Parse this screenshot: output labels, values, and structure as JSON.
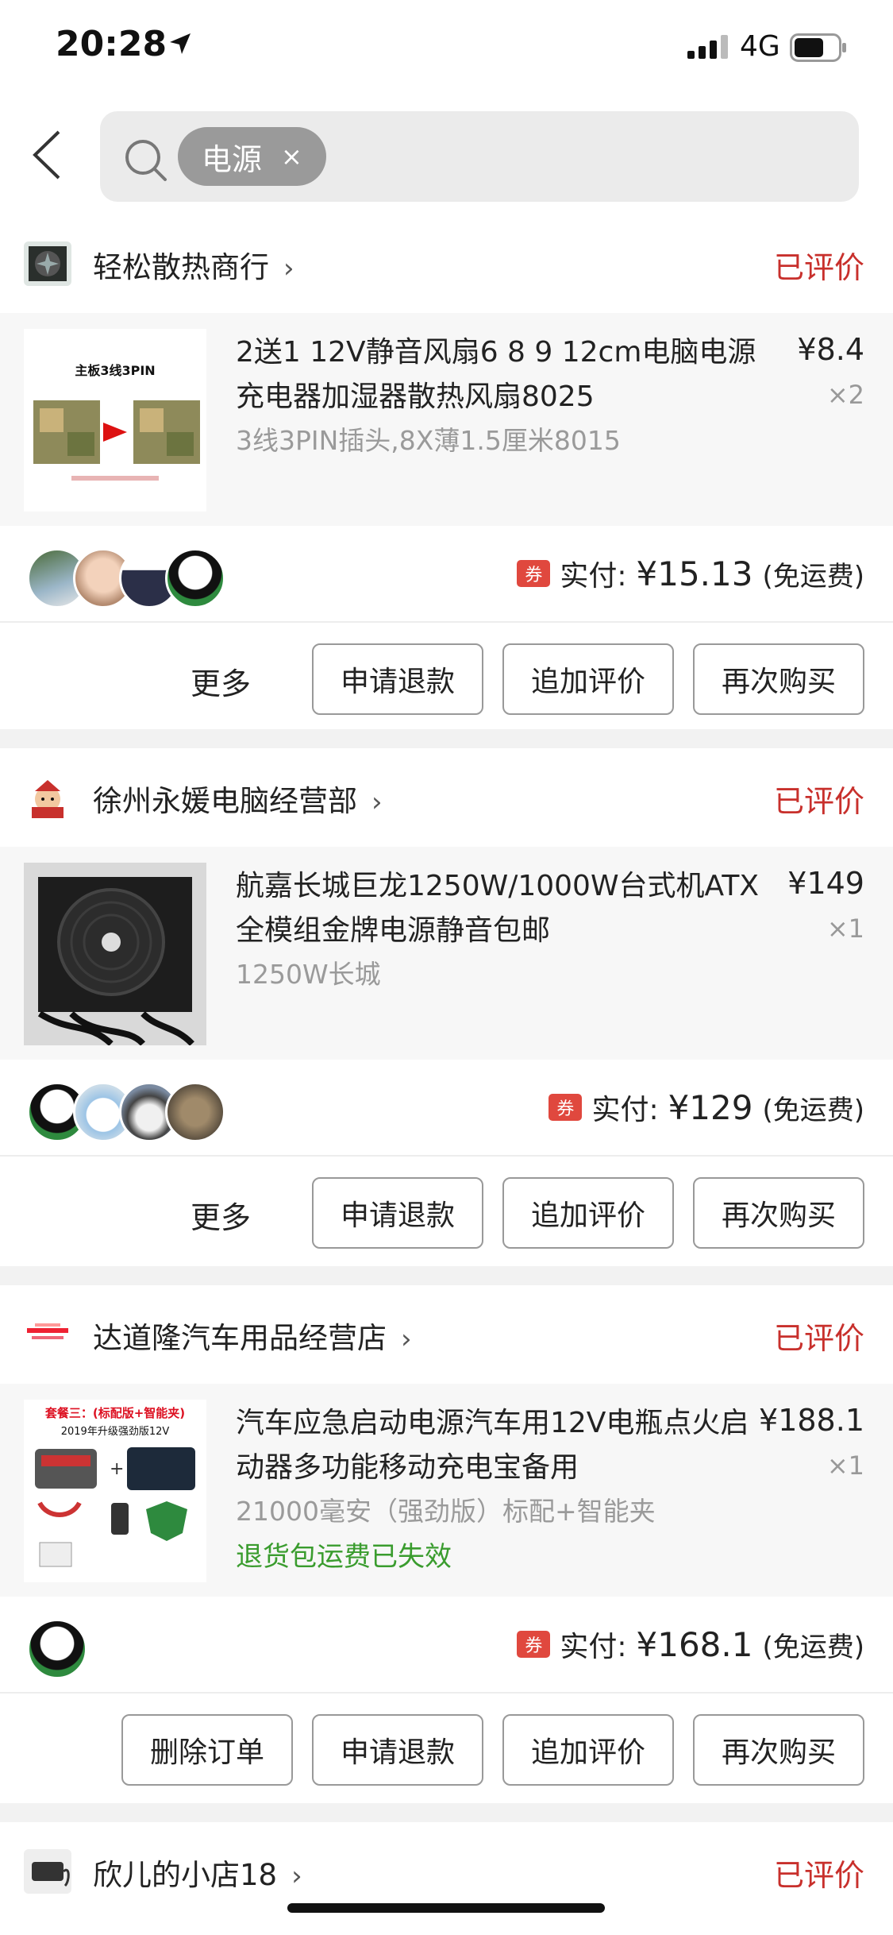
{
  "status_bar": {
    "time": "20:28",
    "network": "4G"
  },
  "search": {
    "tag_label": "电源",
    "tag_remove": "×"
  },
  "orders": [
    {
      "store_name": "轻松散热商行",
      "status": "已评价",
      "product": {
        "title": "2送1 12V静音风扇6 8 9 12cm电脑电源充电器加湿器散热风扇8025",
        "spec": "3线3PIN插头,8X薄1.5厘米8015",
        "price": "¥8.4",
        "qty": "×2",
        "thumb_text": "主板3线3PIN"
      },
      "payment": {
        "label": "实付:",
        "amount": "¥15.13",
        "shipping": "(免运费)",
        "coupon": "券"
      },
      "actions": {
        "more": "更多",
        "refund": "申请退款",
        "add_review": "追加评价",
        "rebuy": "再次购买"
      }
    },
    {
      "store_name": "徐州永媛电脑经营部",
      "status": "已评价",
      "product": {
        "title": "航嘉长城巨龙1250W/1000W台式机ATX全模组金牌电源静音包邮",
        "spec": "1250W长城",
        "price": "¥149",
        "qty": "×1"
      },
      "payment": {
        "label": "实付:",
        "amount": "¥129",
        "shipping": "(免运费)",
        "coupon": "券"
      },
      "actions": {
        "more": "更多",
        "refund": "申请退款",
        "add_review": "追加评价",
        "rebuy": "再次购买"
      }
    },
    {
      "store_name": "达道隆汽车用品经营店",
      "status": "已评价",
      "product": {
        "title": "汽车应急启动电源汽车用12V电瓶点火启动器多功能移动充电宝备用",
        "spec": "21000毫安（强劲版）标配+智能夹",
        "note": "退货包运费已失效",
        "price": "¥188.1",
        "qty": "×1",
        "thumb_text": "套餐三：(标配版+智能夹)",
        "thumb_sub": "2019年升级强劲版12V"
      },
      "payment": {
        "label": "实付:",
        "amount": "¥168.1",
        "shipping": "(免运费)",
        "coupon": "券"
      },
      "actions": {
        "delete": "删除订单",
        "refund": "申请退款",
        "add_review": "追加评价",
        "rebuy": "再次购买"
      }
    },
    {
      "store_name": "欣儿的小店18",
      "status": "已评价"
    }
  ],
  "colors": {
    "accent_red": "#c8302c",
    "note_green": "#3a9c2e",
    "coupon_red": "#e0483e"
  }
}
